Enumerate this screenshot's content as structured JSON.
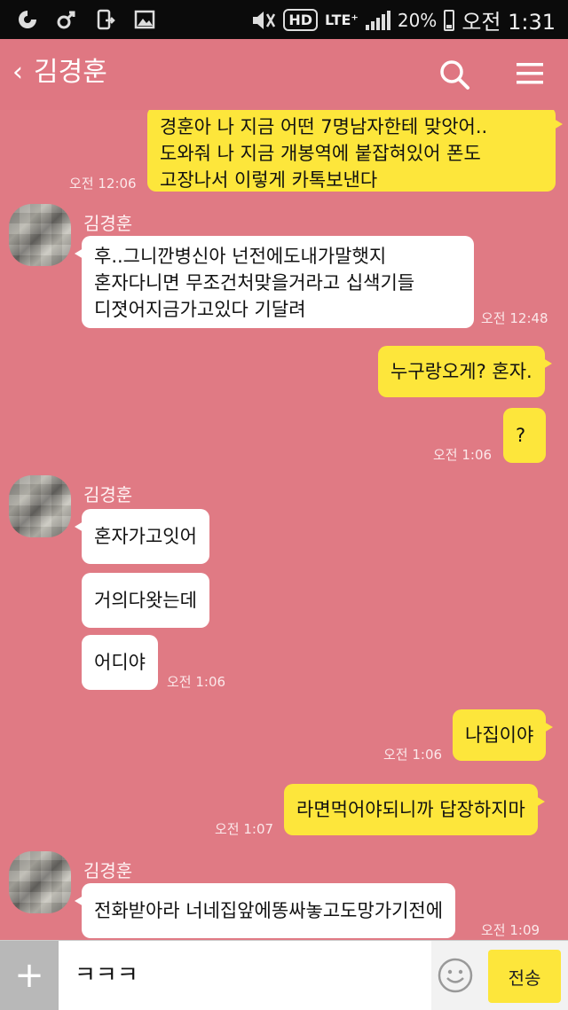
{
  "status_bar": {
    "battery": "20%",
    "time": "오전 1:31",
    "network": "LTE⁺",
    "hd": "HD"
  },
  "header": {
    "back_icon": "‹",
    "title": "김경훈"
  },
  "messages": [
    {
      "side": "me",
      "lines": [
        "경훈아 나 지금 어떤 7명남자한테 맞앗어..",
        "도와줘 나 지금 개봉역에 붙잡혀있어 폰도",
        "고장나서 이렇게 카톡보낸다"
      ],
      "time": "오전 12:06"
    },
    {
      "side": "them",
      "sender": "김경훈",
      "lines": [
        "후..그니깐병신아 넌전에도내가말햇지",
        "혼자다니면 무조건처맞을거라고 십색기들",
        "디졋어지금가고있다 기달려"
      ],
      "time": "오전 12:48"
    },
    {
      "side": "me",
      "lines": [
        "누구랑오게? 혼자."
      ]
    },
    {
      "side": "me",
      "lines": [
        "?"
      ],
      "time": "오전 1:06"
    },
    {
      "side": "them",
      "sender": "김경훈",
      "lines": [
        "혼자가고잇어"
      ]
    },
    {
      "side": "them",
      "lines": [
        "거의다왓는데"
      ]
    },
    {
      "side": "them",
      "lines": [
        "어디야"
      ],
      "time": "오전 1:06"
    },
    {
      "side": "me",
      "lines": [
        "나집이야"
      ],
      "time": "오전 1:06"
    },
    {
      "side": "me",
      "lines": [
        "라면먹어야되니까 답장하지마"
      ],
      "time": "오전 1:07"
    },
    {
      "side": "them",
      "sender": "김경훈",
      "lines": [
        "전화받아라 너네집앞에똥싸놓고도망가기전에"
      ],
      "time": "오전 1:09"
    }
  ],
  "input": {
    "plus_label": "+",
    "value": "ㅋㅋㅋ",
    "send_label": "전송"
  },
  "colors": {
    "background": "#e07a84",
    "my_bubble": "#fde63b",
    "their_bubble": "#ffffff",
    "status_bar": "#0b0b0b"
  },
  "icons": [
    "search-icon",
    "menu-icon",
    "emoji-icon",
    "back-icon"
  ]
}
